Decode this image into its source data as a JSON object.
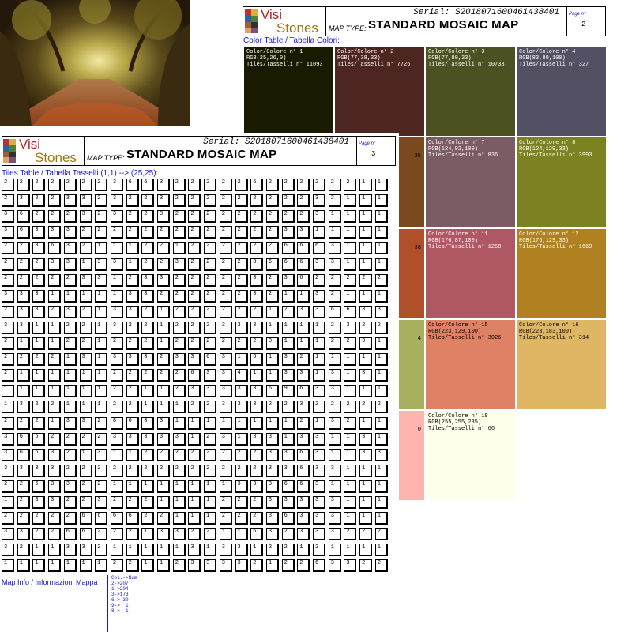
{
  "photo": {
    "alt": ""
  },
  "page2": {
    "logo_line1": "Visi",
    "logo_line2": "Stones",
    "serial": "Serial: S20180716004614384​01",
    "map_type_label": "MAP TYPE:",
    "map_type_value": "STANDARD MOSAIC MAP",
    "page_label": "Page n°",
    "page_number": "2",
    "section_title": "Color Table / Tabella Colori:",
    "swatches": [
      {
        "name": "Color/Colore n° 1",
        "rgb": "RGB(25,26,0)",
        "tiles": "Tiles/Tasselli n° 11093",
        "color": "#191a00",
        "text": "#ffffff"
      },
      {
        "name": "Color/Colore n° 2",
        "rgb": "RGB(77,38,33)",
        "tiles": "Tiles/Tasselli n° 7726",
        "color": "#4d2621",
        "text": "#ffffff"
      },
      {
        "name": "Color/Colore n° 3",
        "rgb": "RGB(77,80,33)",
        "tiles": "Tiles/Tasselli n° 10738",
        "color": "#4d5021",
        "text": "#ffffff"
      },
      {
        "name": "Color/Colore n° 4",
        "rgb": "RGB(83,80,100)",
        "tiles": "Tiles/Tasselli n° 327",
        "color": "#535064",
        "text": "#ffffff"
      },
      {
        "name": "Color/Colore n° 7",
        "rgb": "RGB(124,92,100)",
        "tiles": "Tiles/Tasselli n° 836",
        "color": "#7c5c64",
        "text": "#ffffff"
      },
      {
        "name": "Color/Colore n° 8",
        "rgb": "RGB(124,129,33)",
        "tiles": "Tiles/Tasselli n° 3993",
        "color": "#7c8121",
        "text": "#ffffff"
      },
      {
        "name": "Color/Colore n° 11",
        "rgb": "RGB(176,87,100)",
        "tiles": "Tiles/Tasselli n° 1268",
        "color": "#b05764",
        "text": "#ffffff"
      },
      {
        "name": "Color/Colore n° 12",
        "rgb": "RGB(176,129,33)",
        "tiles": "Tiles/Tasselli n° 1669",
        "color": "#b08121",
        "text": "#ffffff"
      },
      {
        "name": "Color/Colore n° 15",
        "rgb": "RGB(223,129,100)",
        "tiles": "Tiles/Tasselli n° 3026",
        "color": "#df8164",
        "text": "#000000"
      },
      {
        "name": "Color/Colore n° 16",
        "rgb": "RGB(223,183,100)",
        "tiles": "Tiles/Tasselli n° 314",
        "color": "#dfb764",
        "text": "#000000"
      },
      {
        "name": "Color/Colore n° 19",
        "rgb": "RGB(255,255,235)",
        "tiles": "Tiles/Tasselli n° 66",
        "color": "#ffffeb",
        "text": "#000000"
      }
    ],
    "partial_swatches": [
      {
        "fragment": "35",
        "color": "#7a4a1e"
      },
      {
        "fragment": "38",
        "color": "#b0502a"
      },
      {
        "fragment": "4",
        "color": "#a8b060"
      },
      {
        "fragment": "0",
        "color": "#ffb4b0"
      }
    ]
  },
  "page3": {
    "logo_line1": "Visi",
    "logo_line2": "Stones",
    "serial": "Serial: S20180716004614384​01",
    "map_type_label": "MAP TYPE:",
    "map_type_value": "STANDARD MOSAIC MAP",
    "page_label": "Page n°",
    "page_number": "3",
    "section_title": "Tiles Table / Tabella Tasselli (1,1) --> (25,25):",
    "grid": [
      "2222222366322222622222211",
      "2322332322322222222232111",
      "3622232322322222222231111",
      "3633322222222222223311111",
      "2236321112212222226663111",
      "2223313312232222366633111",
      "2222233123322222323622222",
      "3331111133222222321132111",
      "2332321332122222212336633",
      "3311221322122233311112322",
      "2111221222122222231112231",
      "2222131333233631613211111",
      "2111111222226334113313131",
      "1111111221123333369633111",
      "1322111221112233322322222",
      "2221332863311111111213211",
      "3662222333331231331331131",
      "3663213112222222233631133",
      "3333222222222222233633111",
      "2263322111111113336631111",
      "1233223222111122233333111",
      "2222266662211122236333111",
      "3322662221332211632333222",
      "3211332111113133122121111",
      "1111111221123333212263322"
    ],
    "map_info_title": "Map Info / Informazioni Mappa",
    "stats": [
      "Col.->Num",
      "2->207",
      "1->204",
      "3->173",
      "6-> 30",
      "9->  1",
      "8->  1"
    ]
  }
}
